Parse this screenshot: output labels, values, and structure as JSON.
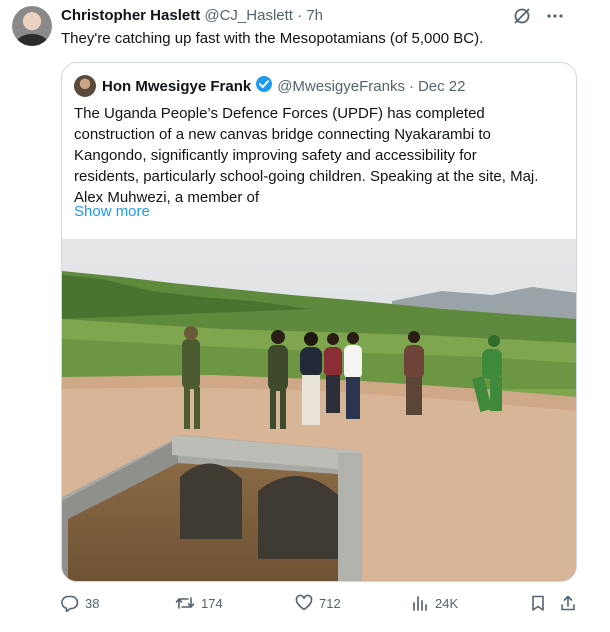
{
  "tweet": {
    "author_name": "Christopher Haslett",
    "author_handle": "@CJ_Haslett",
    "separator": "·",
    "time": "7h",
    "text": "They're catching up fast with the Mesopotamians (of 5,000 BC).",
    "header_icons": [
      "grok-icon",
      "more-icon"
    ]
  },
  "quote": {
    "author_name": "Hon Mwesigye Frank",
    "author_handle": "@MwesigyeFranks",
    "separator": "·",
    "date": "Dec 22",
    "verified": true,
    "text_lines": [
      "The Uganda People’s Defence Forces (UPDF) has completed",
      "construction of a new canvas bridge connecting Nyakarambi to",
      "Kangondo, significantly improving safety and accessibility for",
      "residents, particularly school-going children. Speaking at the site, Maj.",
      "Alex Muhwezi, a member of"
    ],
    "show_more": "Show more"
  },
  "actions": {
    "replies": "38",
    "reposts": "174",
    "likes": "712",
    "views": "24K",
    "icons": [
      "reply-icon",
      "repost-icon",
      "like-icon",
      "views-icon",
      "bookmark-icon",
      "share-icon"
    ]
  },
  "colors": {
    "text": "#0f1419",
    "secondary": "#536471",
    "link": "#1d9bf0",
    "border": "#cfd9de"
  }
}
